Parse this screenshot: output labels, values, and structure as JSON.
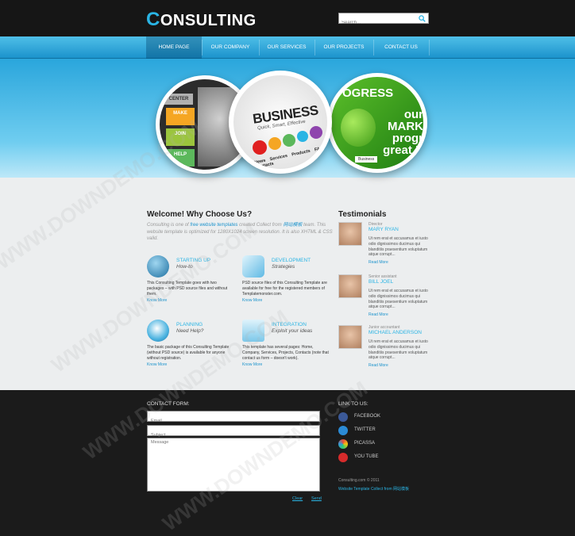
{
  "logo": {
    "first_letter": "C",
    "rest": "ONSULTING"
  },
  "search": {
    "placeholder": "Search..."
  },
  "nav": [
    "HOME PAGE",
    "OUR COMPANY",
    "OUR SERVICES",
    "OUR PROJECTS",
    "CONTACT US"
  ],
  "hero": {
    "left_tiles": [
      "MAKE",
      "JOIN",
      "HELP"
    ],
    "left_center": "CENTER",
    "center_title": "BUSINESS",
    "center_sub": "Quick, Smart, Effective",
    "center_links": "News Services Products FAQ Contacts",
    "right_title": "OGRESS",
    "right_market": "our MARK progr great P",
    "right_small": "Business"
  },
  "welcome": {
    "heading": "Welcome! Why Choose Us?",
    "intro_pre": "Consulting is one of ",
    "intro_link1": "free website templates",
    "intro_mid": " created Collect from ",
    "intro_link2": "网站模板",
    "intro_post": " team. This website template is optimized for 1280X1024 screen resolution. It is also XHTML & CSS valid."
  },
  "features": [
    {
      "title": "STARTING UP",
      "sub": "How-to",
      "text": "This Consulting Template goes with two packages – with PSD source files and without them.",
      "more": "Know More"
    },
    {
      "title": "DEVELOPMENT",
      "sub": "Strategies",
      "text": "PSD source files of this Consulting Template are available for free for the registered members of Templatemonster.com.",
      "more": "Know More"
    },
    {
      "title": "PLANNING",
      "sub": "Need Help?",
      "text": "The basic package of this Consulting Template (without PSD source) is available for anyone without registration.",
      "more": "Know More"
    },
    {
      "title": "INTEGRATION",
      "sub": "Exploit your ideas",
      "text": "This template has several pages: Home, Company, Services, Projects, Contacts (note that contact us form – doesn't work).",
      "more": "Know More"
    }
  ],
  "testimonials": {
    "heading": "Testimonials",
    "items": [
      {
        "role": "Director",
        "name": "MARY RYAN",
        "text": "Ut rem erat et accusamus et iusto odio dignissimos ducimus qui blanditiis praesentium voluptatum atque corrupt...",
        "more": "Read More"
      },
      {
        "role": "Senior assistant",
        "name": "BILL JOEL",
        "text": "Ut rem erat et accusamus et iusto odio dignissimos ducimus qui blanditiis praesentium voluptatum atque corrupt...",
        "more": "Read More"
      },
      {
        "role": "Junior accountant",
        "name": "MICHAEL ANDERSON",
        "text": "Ut rem erat et accusamus et iusto odio dignissimos ducimus qui blanditiis praesentium voluptatum atque corrupt...",
        "more": "Read More"
      }
    ]
  },
  "contact": {
    "heading": "CONTACT FORM:",
    "email_placeholder": "Email",
    "subject_placeholder": "Subject",
    "message_placeholder": "Message",
    "clear": "Clear",
    "send": "Send"
  },
  "links": {
    "heading": "LINK TO US:",
    "items": [
      {
        "label": "FACEBOOK",
        "icon": "facebook-icon",
        "color": "#3b5998"
      },
      {
        "label": "TWITTER",
        "icon": "twitter-icon",
        "color": "#2b8bd6"
      },
      {
        "label": "PICASSA",
        "icon": "picasa-icon",
        "color": "#ffffff"
      },
      {
        "label": "YOU TUBE",
        "icon": "youtube-icon",
        "color": "#d62b2b"
      }
    ]
  },
  "copyright": {
    "line1": "Consulting.com © 2011",
    "line2": "Website Template Collect from 网站模板"
  },
  "watermark": "WWW.DOWNDEMO.COM",
  "colors": {
    "accent": "#2ab4e4",
    "dark": "#161616",
    "light_bg": "#eceeef"
  }
}
